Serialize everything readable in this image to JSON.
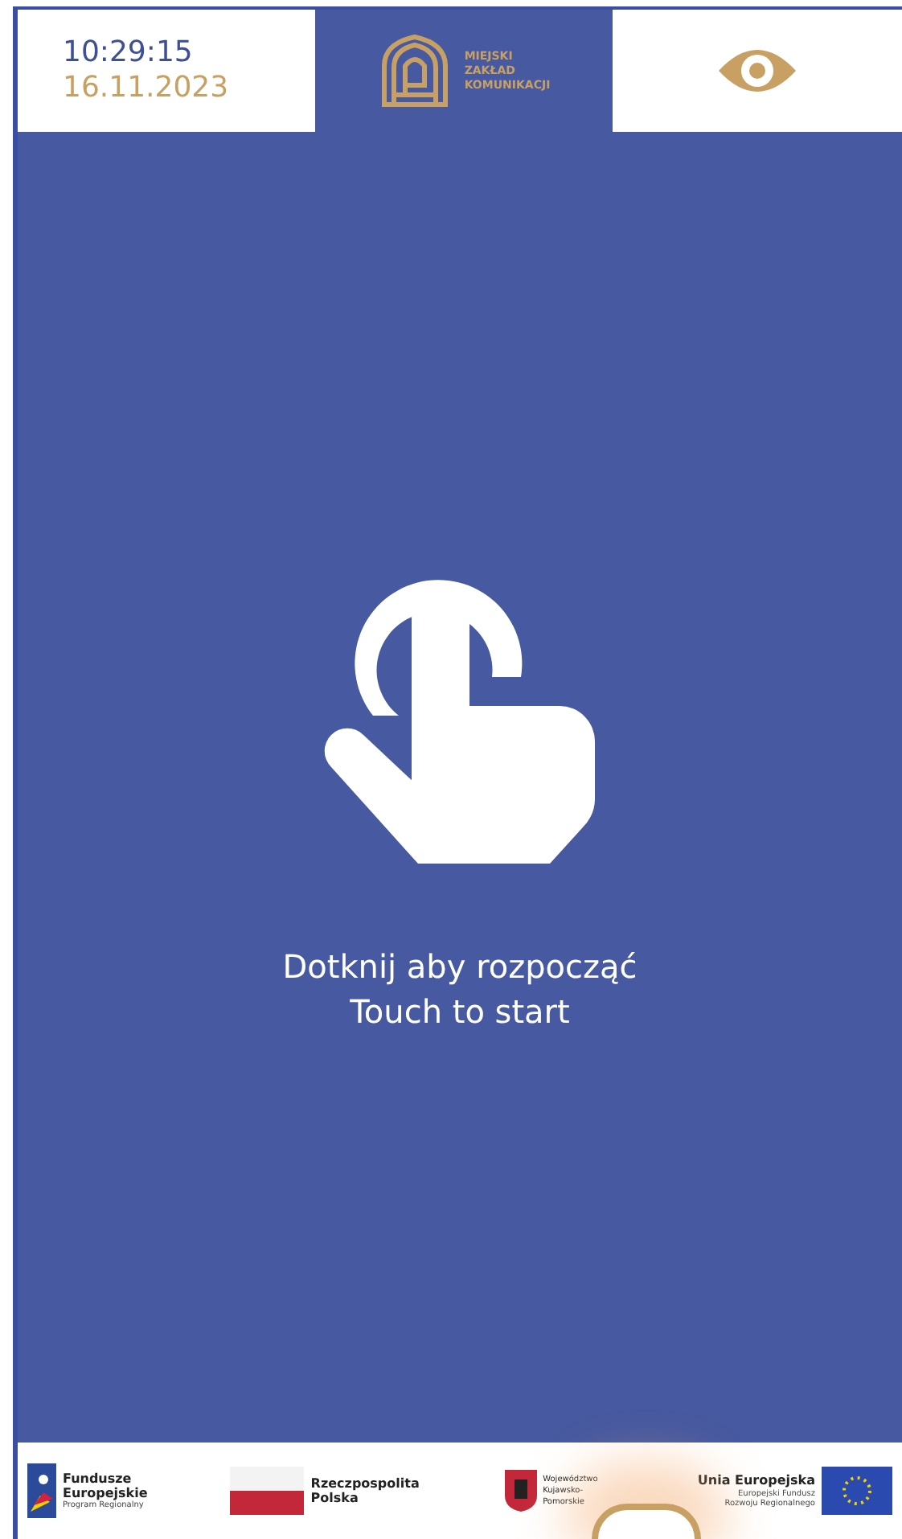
{
  "header": {
    "time": "10:29:15",
    "date": "16.11.2023",
    "logo_lines": [
      "MIEJSKI",
      "ZAKŁAD",
      "KOMUNIKACJI"
    ]
  },
  "prompt": [
    "Dotknij aby rozpocząć",
    "Touch to start"
  ],
  "footer": [
    {
      "kind": "fe",
      "title": "Fundusze Europejskie",
      "subtitle": "Program Regionalny"
    },
    {
      "kind": "rp",
      "title": "Rzeczpospolita Polska"
    },
    {
      "kind": "kp",
      "title": "Województwo Kujawsko-Pomorskie"
    },
    {
      "kind": "ue",
      "title": "Unia Europejska",
      "subtitle": "Europejski Fundusz Rozwoju Regionalnego"
    }
  ]
}
